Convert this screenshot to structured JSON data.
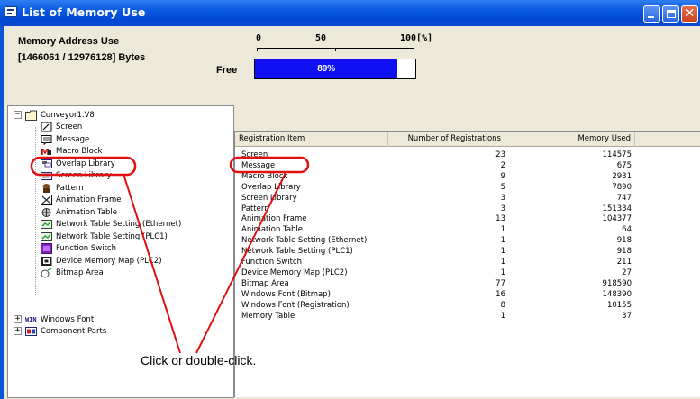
{
  "window": {
    "title": "List of Memory Use",
    "buttons": [
      "minimize-icon",
      "maximize-icon",
      "close-icon"
    ]
  },
  "memory": {
    "title": "Memory Address Use",
    "bytes": "[1466061 / 12976128] Bytes",
    "free_label": "Free",
    "scale": [
      "0",
      "50",
      "100[%]"
    ],
    "free_percent_text": "89%",
    "free_fraction": 0.89,
    "bar_color": "#1010f0"
  },
  "tree": {
    "root": "Conveyor1.V8",
    "items": [
      {
        "label": "Screen",
        "icon": "screen-icon"
      },
      {
        "label": "Message",
        "icon": "message-icon"
      },
      {
        "label": "Macro Block",
        "icon": "macro-block-icon"
      },
      {
        "label": "Overlap Library",
        "icon": "overlap-library-icon"
      },
      {
        "label": "Screen Library",
        "icon": "screen-library-icon"
      },
      {
        "label": "Pattern",
        "icon": "pattern-icon"
      },
      {
        "label": "Animation Frame",
        "icon": "animation-frame-icon"
      },
      {
        "label": "Animation Table",
        "icon": "animation-table-icon"
      },
      {
        "label": "Network Table Setting (Ethernet)",
        "icon": "network-table-icon"
      },
      {
        "label": "Network Table Setting (PLC1)",
        "icon": "network-table-icon"
      },
      {
        "label": "Function Switch",
        "icon": "function-switch-icon"
      },
      {
        "label": "Device Memory Map (PLC2)",
        "icon": "device-memory-map-icon"
      },
      {
        "label": "Bitmap Area",
        "icon": "bitmap-area-icon"
      }
    ],
    "collapsed": [
      {
        "label": "Windows Font",
        "icon_text": "WIN"
      },
      {
        "label": "Component Parts",
        "icon": "component-parts-icon"
      }
    ]
  },
  "list": {
    "columns": [
      "Registration Item",
      "Number of Registrations",
      "Memory Used"
    ],
    "rows": [
      {
        "item": "Screen",
        "count": "23",
        "memory": "114575"
      },
      {
        "item": "Message",
        "count": "2",
        "memory": "675"
      },
      {
        "item": "Macro Block",
        "count": "9",
        "memory": "2931"
      },
      {
        "item": "Overlap Library",
        "count": "5",
        "memory": "7890"
      },
      {
        "item": "Screen Library",
        "count": "3",
        "memory": "747"
      },
      {
        "item": "Pattern",
        "count": "3",
        "memory": "151334"
      },
      {
        "item": "Animation Frame",
        "count": "13",
        "memory": "104377"
      },
      {
        "item": "Animation Table",
        "count": "1",
        "memory": "64"
      },
      {
        "item": "Network Table Setting (Ethernet)",
        "count": "1",
        "memory": "918"
      },
      {
        "item": "Network Table Setting (PLC1)",
        "count": "1",
        "memory": "918"
      },
      {
        "item": "Function Switch",
        "count": "1",
        "memory": "211"
      },
      {
        "item": "Device Memory Map (PLC2)",
        "count": "1",
        "memory": "27"
      },
      {
        "item": "Bitmap Area",
        "count": "77",
        "memory": "918590"
      },
      {
        "item": "Windows Font (Bitmap)",
        "count": "16",
        "memory": "148390"
      },
      {
        "item": "Windows Font (Registration)",
        "count": "8",
        "memory": "10155"
      },
      {
        "item": "Memory Table",
        "count": "1",
        "memory": "37"
      }
    ]
  },
  "annotation": {
    "text": "Click or double-click.",
    "color": "#e01010"
  }
}
